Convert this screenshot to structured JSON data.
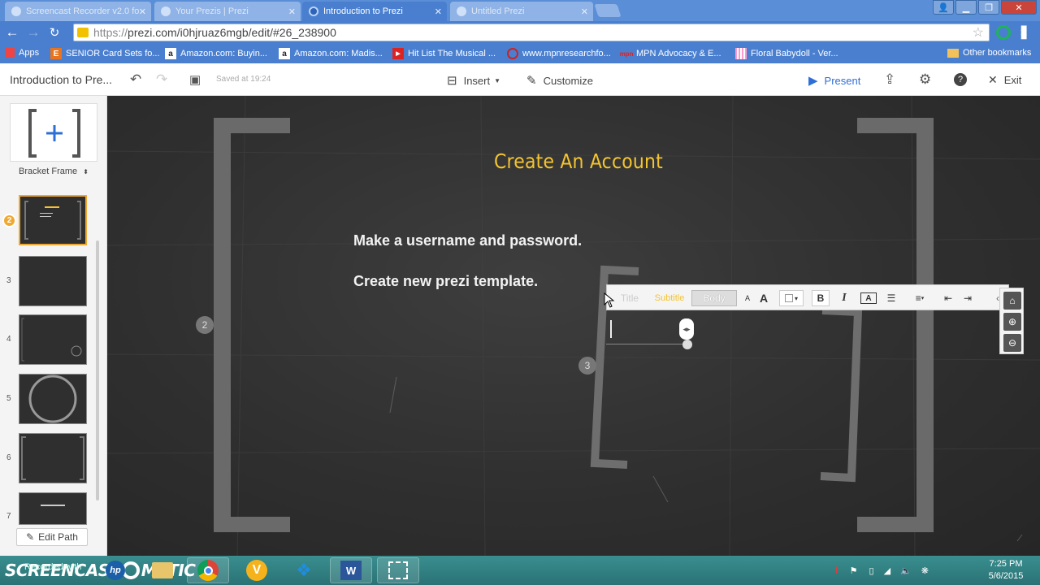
{
  "browser": {
    "tabs": [
      {
        "label": "Screencast Recorder v2.0 fo",
        "active": false
      },
      {
        "label": "Your Prezis | Prezi",
        "active": false
      },
      {
        "label": "Introduction to Prezi",
        "active": true
      },
      {
        "label": "Untitled Prezi",
        "active": false
      }
    ],
    "url_prefix": "https://",
    "url_host": "prezi.com",
    "url_path": "/i0hjruaz6mgb/edit/#26_238900",
    "bookmarks": [
      {
        "label": "Apps"
      },
      {
        "label": "SENIOR Card Sets fo..."
      },
      {
        "label": "Amazon.com: Buyin..."
      },
      {
        "label": "Amazon.com: Madis..."
      },
      {
        "label": "Hit List The Musical ..."
      },
      {
        "label": "www.mpnresearchfo..."
      },
      {
        "label": "MPN Advocacy & E..."
      },
      {
        "label": "Floral Babydoll - Ver..."
      }
    ],
    "other_bookmarks": "Other bookmarks"
  },
  "prezi": {
    "title": "Introduction to Pre...",
    "saved": "Saved at 19:24",
    "insert": "Insert",
    "customize": "Customize",
    "present": "Present",
    "exit": "Exit"
  },
  "sidebar": {
    "frame_type": "Bracket Frame",
    "active_badge": "2",
    "thumb_numbers": [
      "3",
      "4",
      "5",
      "6",
      "7"
    ],
    "edit_path": "Edit Path"
  },
  "canvas": {
    "slide_title": "Create An Account",
    "body_lines": [
      "Make a username and password.",
      "Create new prezi template."
    ],
    "frame_labels": [
      "2",
      "3"
    ]
  },
  "format_toolbar": {
    "styles": [
      "Title",
      "Subtitle",
      "Body"
    ],
    "selected_style": "Body",
    "font_size_small": "A",
    "font_size_large": "A",
    "bold": "B",
    "italic": "I",
    "highlight": "A"
  },
  "taskbar": {
    "recorder_brand": "SCREENCAST",
    "recorder_brand_2": "MATIC",
    "recorder_sub": "Recorded with",
    "time": "7:25 PM",
    "date": "5/6/2015"
  },
  "colors": {
    "title_yellow": "#f4c430",
    "accent_blue": "#2e6fd6",
    "active_thumb": "#f0a830"
  }
}
